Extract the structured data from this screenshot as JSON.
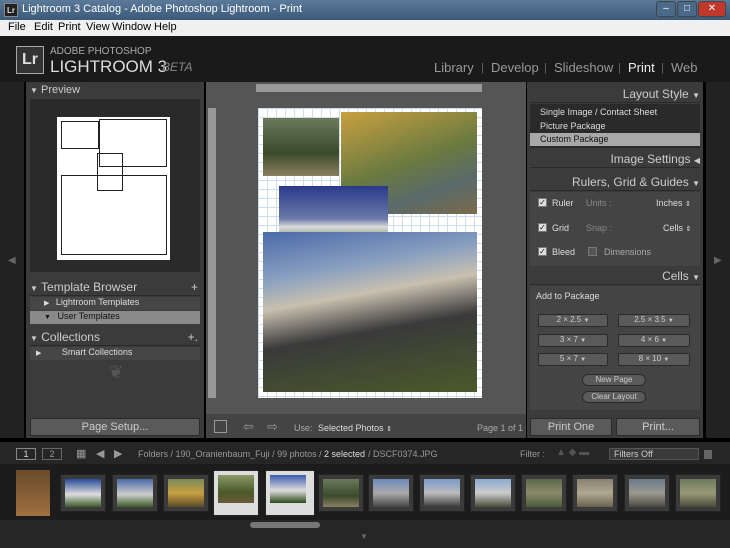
{
  "window": {
    "title": "Lightroom 3 Catalog - Adobe Photoshop Lightroom - Print",
    "icon_text": "Lr",
    "minimize": "–",
    "maximize": "□",
    "close": "✕"
  },
  "menu": [
    "File",
    "Edit",
    "Print",
    "View",
    "Window",
    "Help"
  ],
  "identity": {
    "line1": "ADOBE PHOTOSHOP",
    "line2": "LIGHTROOM 3",
    "beta": "BETA",
    "logo": "Lr"
  },
  "modules": [
    "Library",
    "Develop",
    "Slideshow",
    "Print",
    "Web"
  ],
  "active_module": "Print",
  "left": {
    "preview_title": "Preview",
    "template_browser": "Template Browser",
    "templates": [
      "Lightroom Templates",
      "User Templates"
    ],
    "collections": "Collections",
    "collection_items": [
      "Smart Collections"
    ],
    "page_setup": "Page Setup..."
  },
  "right": {
    "layout_style": "Layout Style",
    "layout_options": [
      "Single Image / Contact Sheet",
      "Picture Package",
      "Custom Package"
    ],
    "selected_layout": "Custom Package",
    "image_settings": "Image Settings",
    "rulers": "Rulers, Grid & Guides",
    "ruler_label": "Ruler",
    "units_label": "Units :",
    "units_value": "Inches",
    "grid_label": "Grid",
    "snap_label": "Snap :",
    "snap_value": "Cells",
    "bleed_label": "Bleed",
    "dimensions_label": "Dimensions",
    "cells": "Cells",
    "add_to_package": "Add to Package",
    "sizes": [
      "2 × 2.5",
      "2.5 × 3.5",
      "3 × 7",
      "4 × 6",
      "5 × 7",
      "8 × 10"
    ],
    "new_page": "New Page",
    "clear_layout": "Clear Layout",
    "print_one": "Print One",
    "print": "Print..."
  },
  "toolbar": {
    "use_label": "Use:",
    "use_value": "Selected Photos",
    "page_label": "Page 1 of 1"
  },
  "filmstrip": {
    "page1": "1",
    "page2": "2",
    "path": "Folders / 190_Oranienbaum_Fuji / 99 photos /",
    "selected": "2 selected",
    "file": "/ DSCF0374.JPG",
    "filter_label": "Filter :",
    "filter_value": "Filters Off"
  }
}
